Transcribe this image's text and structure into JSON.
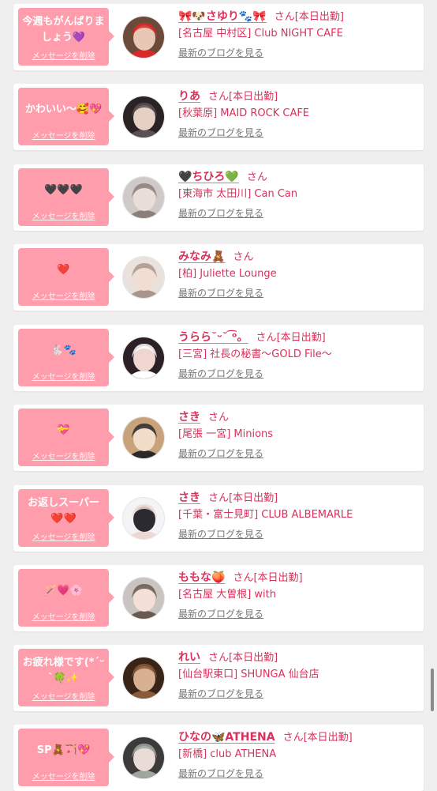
{
  "cards": [
    {
      "message": "今週もがんばりましょう💜",
      "delete_label": "メッセージを削除",
      "name": "🎀🐶さゆり🐾🎀",
      "san": "さん",
      "today": "[本日出勤]",
      "shop": "[名古屋 中村区] Club NIGHT CAFE",
      "blog_label": "最新のブログを見る",
      "avatar_colors": [
        "#6b4a3a",
        "#e8c8b4",
        "#d82a2a"
      ]
    },
    {
      "message": "かわいい〜🥰💖",
      "delete_label": "メッセージを削除",
      "name": "りあ",
      "san": "さん",
      "today": "[本日出勤]",
      "shop": "[秋葉原] MAID ROCK CAFE",
      "blog_label": "最新のブログを見る",
      "avatar_colors": [
        "#2a2324",
        "#e6cfc3",
        "#5a4f53"
      ]
    },
    {
      "message": "🖤🖤🖤",
      "delete_label": "メッセージを削除",
      "name": "🖤ちひろ💚",
      "san": "さん",
      "today": "",
      "shop": "[東海市 太田川] Can Can",
      "blog_label": "最新のブログを見る",
      "avatar_colors": [
        "#cfcac8",
        "#eadfd8",
        "#8b7f7c"
      ]
    },
    {
      "message": "❤️",
      "delete_label": "メッセージを削除",
      "name": "みなみ🧸",
      "san": "さん",
      "today": "",
      "shop": "[柏] Juliette Lounge",
      "blog_label": "最新のブログを見る",
      "avatar_colors": [
        "#e9e1dc",
        "#f1ddd2",
        "#a8968c"
      ]
    },
    {
      "message": "🐇🐾",
      "delete_label": "メッセージを削除",
      "name": "うらら˘ᵕ˘ ͡ᵒ。",
      "san": "さん",
      "today": "[本日出勤]",
      "shop": "[三宮] 社長の秘書〜GOLD File〜",
      "blog_label": "最新のブログを見る",
      "avatar_colors": [
        "#2b2025",
        "#f0d6d0",
        "#ffffff"
      ]
    },
    {
      "message": "💝",
      "delete_label": "メッセージを削除",
      "name": "さき",
      "san": "さん",
      "today": "",
      "shop": "[尾張 一宮] Minions",
      "blog_label": "最新のブログを見る",
      "avatar_colors": [
        "#c8a27a",
        "#f2dcca",
        "#2a2a2a"
      ]
    },
    {
      "message": "お返しスーパー❤️❤️",
      "delete_label": "メッセージを削除",
      "name": "さき",
      "san": "さん",
      "today": "[本日出勤]",
      "shop": "[千葉・富士見町] CLUB ALBEMARLE",
      "blog_label": "最新のブログを見る",
      "avatar_colors": [
        "#f4f4f6",
        "#2a2a30",
        "#ecd8d0"
      ]
    },
    {
      "message": "🪄💗🌸",
      "delete_label": "メッセージを削除",
      "name": "ももな🍑",
      "san": "さん",
      "today": "[本日出勤]",
      "shop": "[名古屋 大曽根] with",
      "blog_label": "最新のブログを見る",
      "avatar_colors": [
        "#c9c3c1",
        "#f3e0d6",
        "#6a5a52"
      ]
    },
    {
      "message": "お疲れ様です(*ˊᵕˋ🍀✨",
      "delete_label": "メッセージを削除",
      "name": "れい",
      "san": "さん",
      "today": "[本日出勤]",
      "shop": "[仙台駅東口] SHUNGA 仙台店",
      "blog_label": "最新のブログを見る",
      "avatar_colors": [
        "#3a2418",
        "#d8b092",
        "#8a5a3a"
      ]
    },
    {
      "message": "SP🧸🏹💖",
      "delete_label": "メッセージを削除",
      "name": "ひなの🦋ATHENA",
      "san": "さん",
      "today": "[本日出勤]",
      "shop": "[新橋] club ATHENA",
      "blog_label": "最新のブログを見る",
      "avatar_colors": [
        "#3d3a3a",
        "#e9dcd6",
        "#9fa6a0"
      ]
    }
  ],
  "colors": {
    "bubble": "#ff9dad",
    "accent": "#d9315a",
    "link_gray": "#777777",
    "background": "#efefef"
  }
}
